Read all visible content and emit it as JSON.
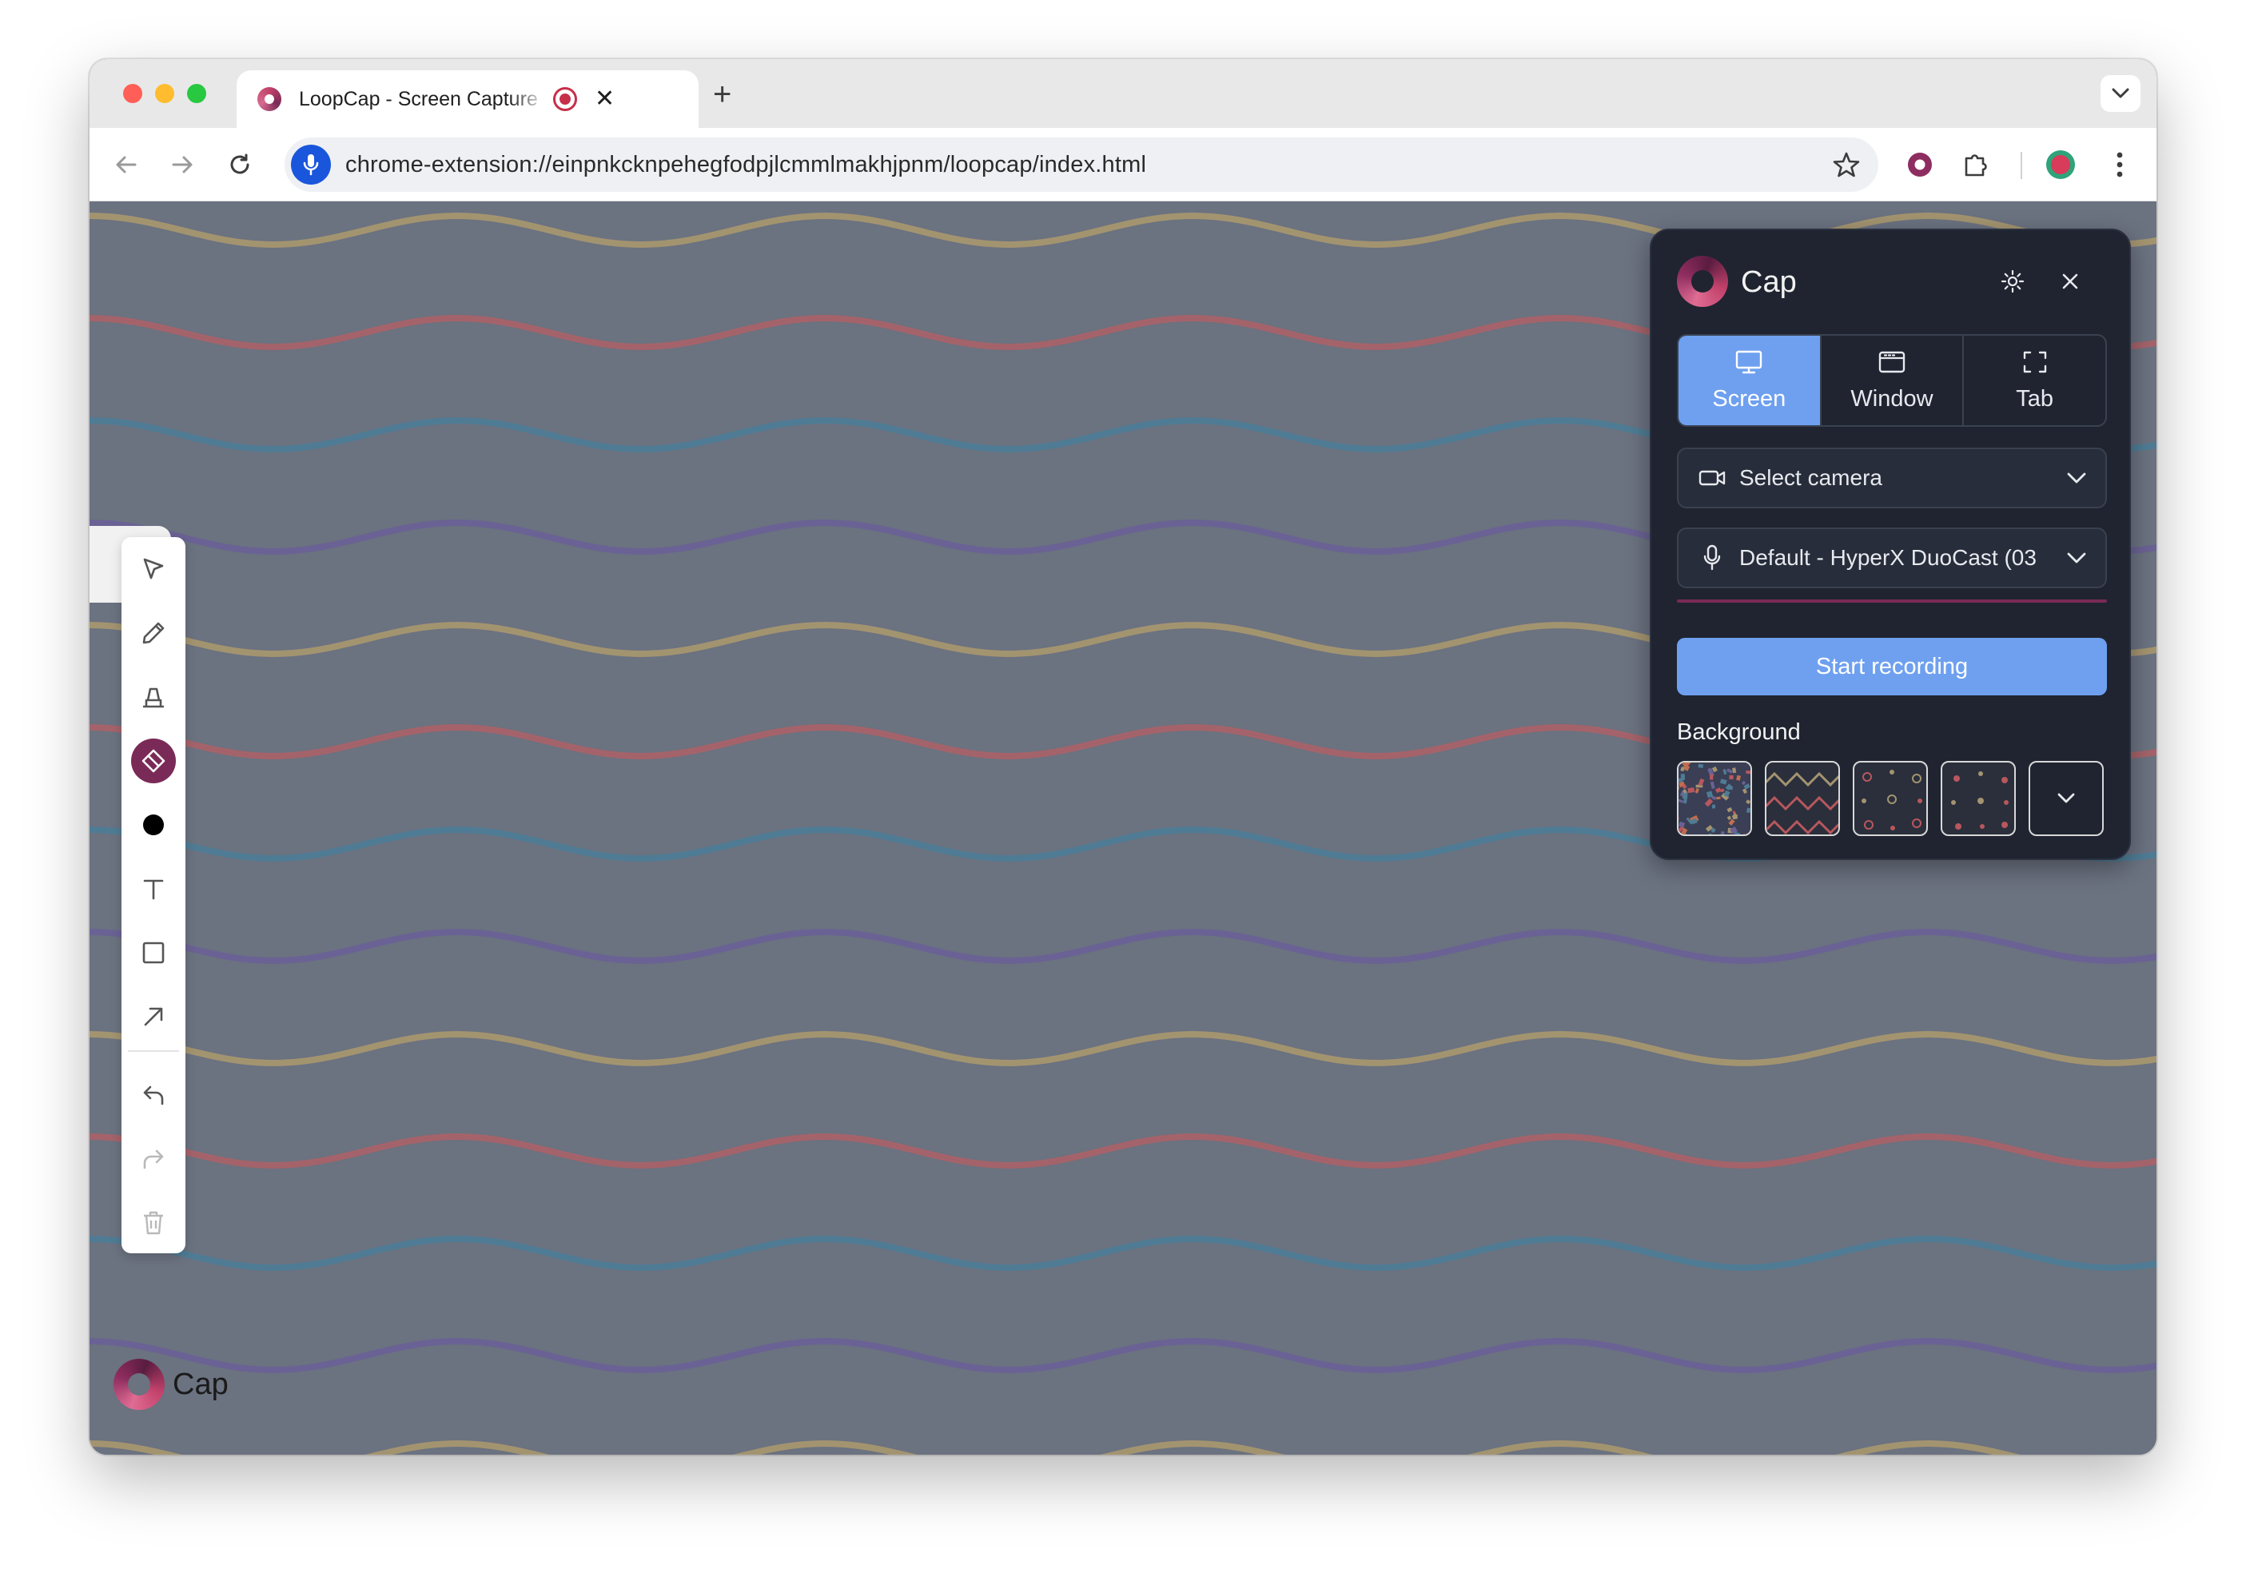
{
  "browser": {
    "tab_title": "LoopCap - Screen Capture",
    "tab_close": "✕",
    "new_tab": "+",
    "url": "chrome-extension://einpnkcknpehegfodpjlcmmlmakhjpnm/loopcap/index.html"
  },
  "draw_toolbar": {
    "tools": [
      {
        "name": "select-tool",
        "icon": "cursor-icon"
      },
      {
        "name": "pen-tool",
        "icon": "pencil-icon"
      },
      {
        "name": "highlighter-tool",
        "icon": "highlighter-icon"
      },
      {
        "name": "eraser-tool",
        "icon": "eraser-icon",
        "active": true
      },
      {
        "name": "color-tool",
        "icon": "color-dot-icon",
        "color": "#000000"
      },
      {
        "name": "text-tool",
        "icon": "text-icon"
      },
      {
        "name": "rectangle-tool",
        "icon": "square-icon"
      },
      {
        "name": "arrow-tool",
        "icon": "arrow-icon"
      },
      {
        "name": "undo-button",
        "icon": "undo-icon"
      },
      {
        "name": "redo-button",
        "icon": "redo-icon"
      },
      {
        "name": "delete-button",
        "icon": "trash-icon"
      }
    ]
  },
  "watermark": {
    "label": "Cap"
  },
  "panel": {
    "title": "Cap",
    "modes": [
      {
        "label": "Screen",
        "icon": "monitor-icon",
        "active": true
      },
      {
        "label": "Window",
        "icon": "window-icon",
        "active": false
      },
      {
        "label": "Tab",
        "icon": "fullscreen-icon",
        "active": false
      }
    ],
    "camera_select": "Select camera",
    "mic_select": "Default - HyperX DuoCast (03",
    "start_label": "Start recording",
    "background_label": "Background"
  },
  "colors": {
    "accent": "#6ea0ef",
    "brand": "#7a2a57",
    "panel_bg": "#1f2430",
    "page_bg": "#6b7280",
    "wave_yellow": "#a39470",
    "wave_red": "#a4636a",
    "wave_blue": "#4f7c94",
    "wave_purple": "#6a6294"
  }
}
